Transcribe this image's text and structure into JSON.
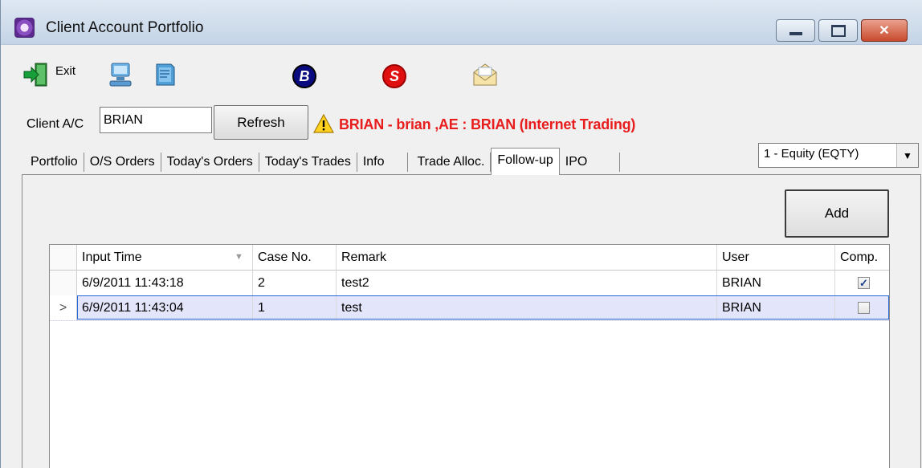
{
  "window": {
    "title": "Client Account Portfolio"
  },
  "toolbar": {
    "exit_label": "Exit",
    "icons": [
      "exit-icon",
      "computer-icon",
      "book-icon",
      "buy-icon",
      "sell-icon",
      "mail-icon"
    ],
    "buy_letter": "B",
    "sell_letter": "S"
  },
  "client": {
    "label": "Client A/C",
    "value": "BRIAN",
    "refresh_label": "Refresh",
    "info": "BRIAN - brian ,AE : BRIAN (Internet Trading)"
  },
  "tabs": [
    {
      "label": "Portfolio"
    },
    {
      "label": "O/S Orders"
    },
    {
      "label": "Today's Orders"
    },
    {
      "label": "Today's Trades"
    },
    {
      "label": "Info"
    },
    {
      "label": "Trade Alloc."
    },
    {
      "label": "Follow-up"
    },
    {
      "label": "IPO"
    }
  ],
  "active_tab": "Follow-up",
  "account_select": {
    "value": "1 - Equity (EQTY)"
  },
  "followup": {
    "add_label": "Add",
    "columns": [
      "Input Time",
      "Case No.",
      "Remark",
      "User",
      "Comp."
    ],
    "rows": [
      {
        "input_time": "6/9/2011 11:43:18",
        "case_no": "2",
        "remark": "test2",
        "user": "BRIAN",
        "comp": true
      },
      {
        "input_time": "6/9/2011 11:43:04",
        "case_no": "1",
        "remark": "test",
        "user": "BRIAN",
        "comp": false,
        "current": true
      }
    ],
    "current_row_marker": ">"
  },
  "colors": {
    "info_text": "#e81d1d",
    "selected_row": "#e3e5fa",
    "close_button": "#c84a2c"
  }
}
